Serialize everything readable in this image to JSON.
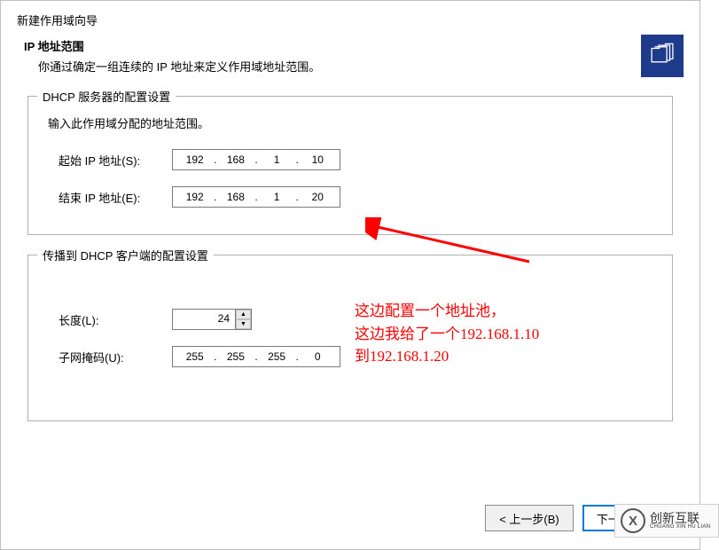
{
  "wizard": {
    "title": "新建作用域向导",
    "section_title": "IP 地址范围",
    "section_subtitle": "你通过确定一组连续的 IP 地址来定义作用域地址范围。"
  },
  "dhcp_server": {
    "legend": "DHCP 服务器的配置设置",
    "description": "输入此作用域分配的地址范围。",
    "start_label": "起始 IP 地址(S):",
    "start_ip": {
      "o1": "192",
      "o2": "168",
      "o3": "1",
      "o4": "10"
    },
    "end_label": "结束 IP 地址(E):",
    "end_ip": {
      "o1": "192",
      "o2": "168",
      "o3": "1",
      "o4": "20"
    }
  },
  "dhcp_client": {
    "legend": "传播到 DHCP 客户端的配置设置",
    "length_label": "长度(L):",
    "length_value": "24",
    "mask_label": "子网掩码(U):",
    "mask": {
      "o1": "255",
      "o2": "255",
      "o3": "255",
      "o4": "0"
    }
  },
  "buttons": {
    "back": "< 上一步(B)",
    "next": "下一步(N) >"
  },
  "annotation": {
    "line1": "这边配置一个地址池，",
    "line2": "这边我给了一个192.168.1.10",
    "line3": "到192.168.1.20"
  },
  "logo": {
    "mark": "X",
    "text_top": "创新互联",
    "text_bottom": "CHUANG XIN HU LIAN"
  }
}
